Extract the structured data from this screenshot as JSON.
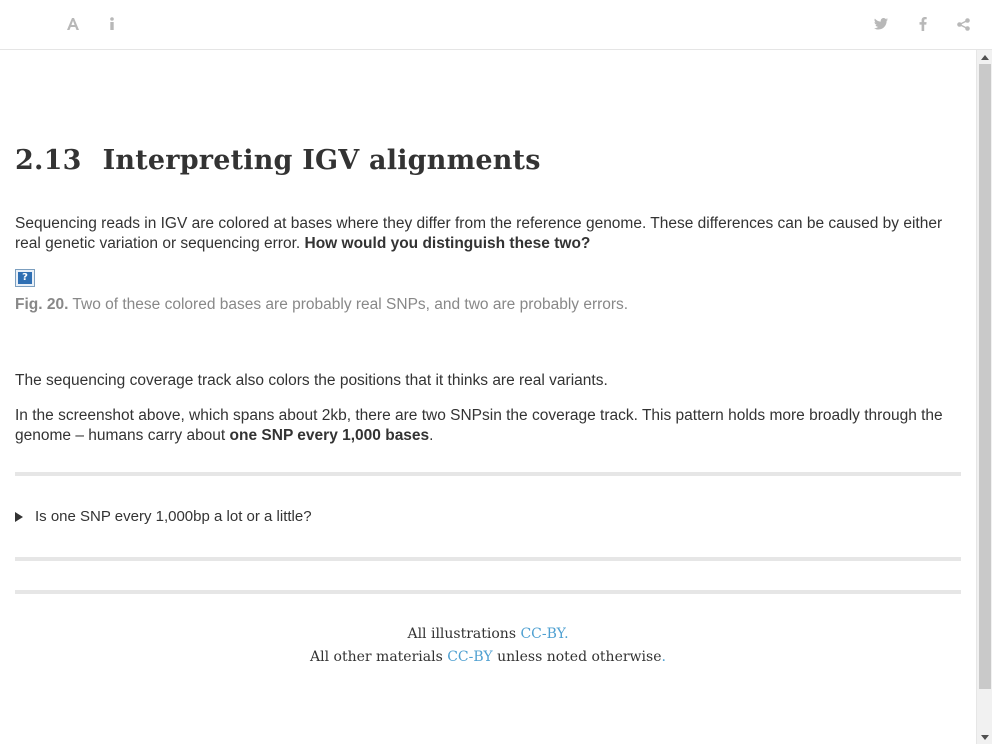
{
  "toolbar": {
    "left_icons": [
      "font-settings-icon",
      "info-icon"
    ],
    "right_icons": [
      "twitter-icon",
      "facebook-icon",
      "share-icon"
    ]
  },
  "section": {
    "number": "2.13",
    "title": "Interpreting IGV alignments"
  },
  "para1": {
    "text": "Sequencing reads in IGV are colored at bases where they differ from the reference genome. These differences can be caused by either real genetic variation or sequencing error. ",
    "bold": "How would you distinguish these two?"
  },
  "figure": {
    "broken_image_glyph": "?",
    "label": "Fig. 20.",
    "caption": "Two of these colored bases are probably real SNPs, and two are probably errors."
  },
  "para2": {
    "text": "The sequencing coverage track also colors the positions that it thinks are real variants."
  },
  "para3": {
    "text": "In the screenshot above, which spans about 2kb, there are two SNPsin the coverage track. This pattern holds more broadly through the genome – humans carry about ",
    "bold": "one SNP every 1,000 bases",
    "end": "."
  },
  "details": {
    "summary": "Is one SNP every 1,000bp a lot or a little?"
  },
  "footer": {
    "line1_prefix": "All illustrations ",
    "line1_link": "CC-BY.",
    "line2_prefix": "All other materials ",
    "line2_link": "CC-BY",
    "line2_suffix": " unless noted otherwise",
    "line2_end": "."
  },
  "colors": {
    "link": "#4fa0d1",
    "icon": "#b8b8b8",
    "caption": "#888888",
    "rule": "#e6e6e6"
  }
}
